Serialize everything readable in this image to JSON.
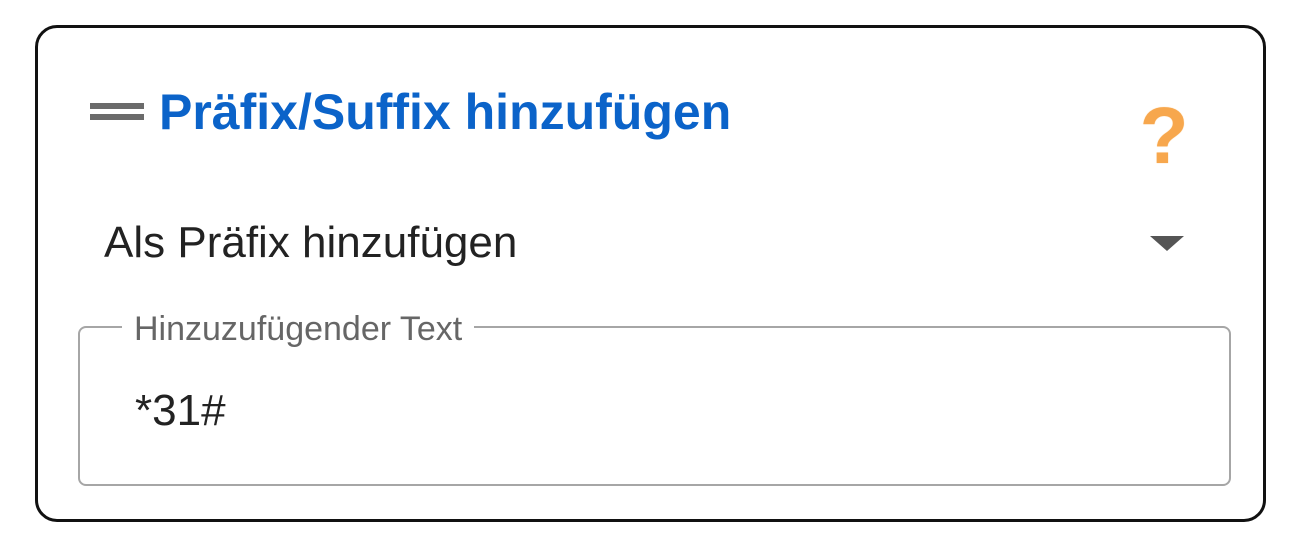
{
  "card": {
    "title": "Präfix/Suffix hinzufügen",
    "help_glyph": "?",
    "icons": {
      "drag": "drag-handle-icon",
      "help": "question-mark-icon",
      "dropdown": "caret-down-icon"
    },
    "colors": {
      "title": "#0b63c9",
      "help": "#f7a74d",
      "border": "#111111"
    }
  },
  "mode_select": {
    "selected": "Als Präfix hinzufügen"
  },
  "text_field": {
    "label": "Hinzuzufügender Text",
    "value": "*31#"
  }
}
